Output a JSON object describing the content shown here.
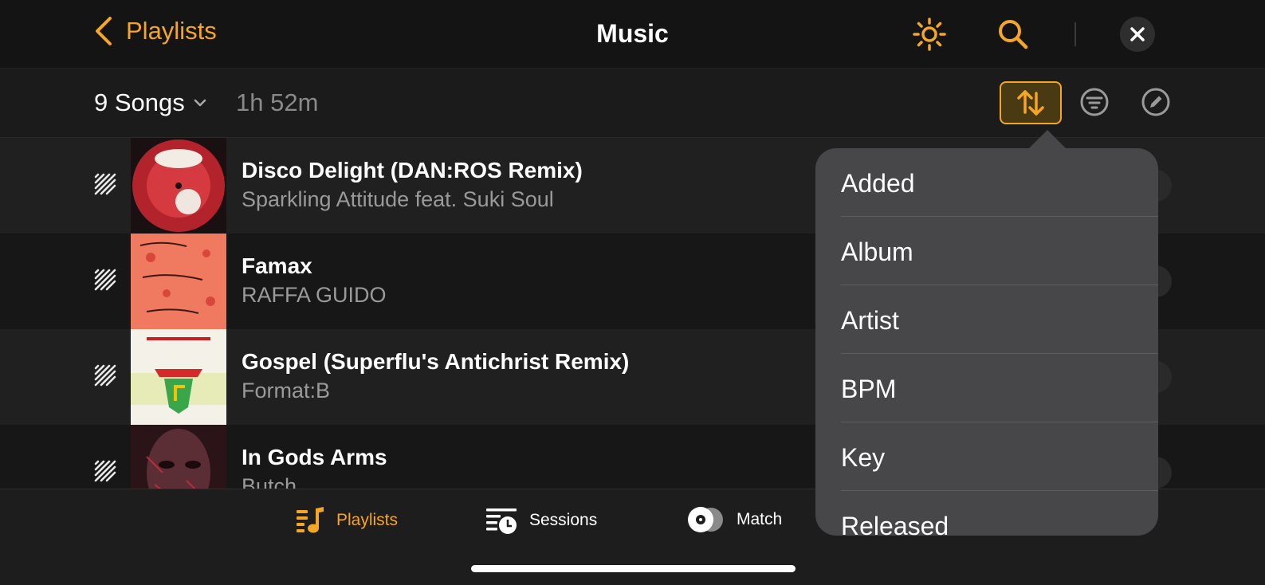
{
  "header": {
    "back_label": "Playlists",
    "title": "Music",
    "accent_color": "#f5a623"
  },
  "toolbar": {
    "song_count": "9 Songs",
    "duration": "1h 52m"
  },
  "songs": [
    {
      "title": "Disco Delight (DAN:ROS Remix)",
      "artist": "Sparkling Attitude feat. Suki Soul"
    },
    {
      "title": "Famax",
      "artist": "RAFFA GUIDO"
    },
    {
      "title": "Gospel (Superflu's Antichrist Remix)",
      "artist": "Format:B"
    },
    {
      "title": "In Gods Arms",
      "artist": "Butch"
    }
  ],
  "sort_menu": {
    "items": [
      "Added",
      "Album",
      "Artist",
      "BPM",
      "Key",
      "Released"
    ]
  },
  "tabs": [
    {
      "label": "Playlists",
      "active": true
    },
    {
      "label": "Sessions",
      "active": false
    },
    {
      "label": "Match",
      "active": false
    }
  ],
  "icons": {
    "back": "chevron-left-icon",
    "brightness": "sun-icon",
    "search": "search-icon",
    "close": "close-icon",
    "sort": "sort-arrows-icon",
    "filter": "filter-icon",
    "edit": "pencil-icon",
    "track_status": "vinyl-striped-icon"
  }
}
